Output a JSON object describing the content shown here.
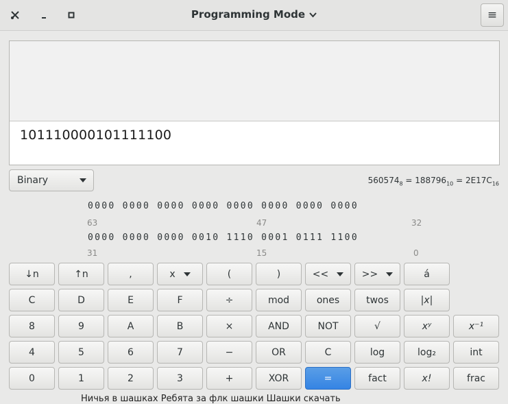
{
  "window": {
    "title": "Programming Mode",
    "menu_label": "≡",
    "minimize_label": "_",
    "maximize_label": "▫",
    "close_label": "✕"
  },
  "display": {
    "history": "",
    "entry": "101110000101111100"
  },
  "base_select": {
    "value": "Binary"
  },
  "conversion": {
    "oct_value": "560574",
    "oct_sub": "8",
    "dec_value": "188796",
    "dec_sub": "10",
    "hex_value": "2E17C",
    "hex_sub": "16",
    "eq": " = "
  },
  "bits": {
    "row1": "0000 0000 0000 0000 0000 0000 0000 0000",
    "row2": "0000 0000 0000 0010 1110 0001 0111 1100",
    "idx": [
      "63",
      "47",
      "32",
      "31",
      "15",
      "0"
    ]
  },
  "keypad": {
    "row0": [
      "↓n",
      "↑n",
      ",",
      "x",
      "(",
      ")",
      "<<",
      ">>",
      "á"
    ],
    "row1": [
      "C",
      "D",
      "E",
      "F",
      "÷",
      "mod",
      "ones",
      "twos",
      "|x|"
    ],
    "row2": [
      "8",
      "9",
      "A",
      "B",
      "×",
      "AND",
      "NOT",
      "√",
      "xʸ",
      "x⁻¹"
    ],
    "row3": [
      "4",
      "5",
      "6",
      "7",
      "−",
      "OR",
      "C",
      "log",
      "log₂",
      "int"
    ],
    "row4": [
      "0",
      "1",
      "2",
      "3",
      "+",
      "XOR",
      "=",
      "fact",
      "x!",
      "frac"
    ]
  },
  "bottom_text": "Ничья в шашках Ребята за флк шашки Шашки скачать"
}
